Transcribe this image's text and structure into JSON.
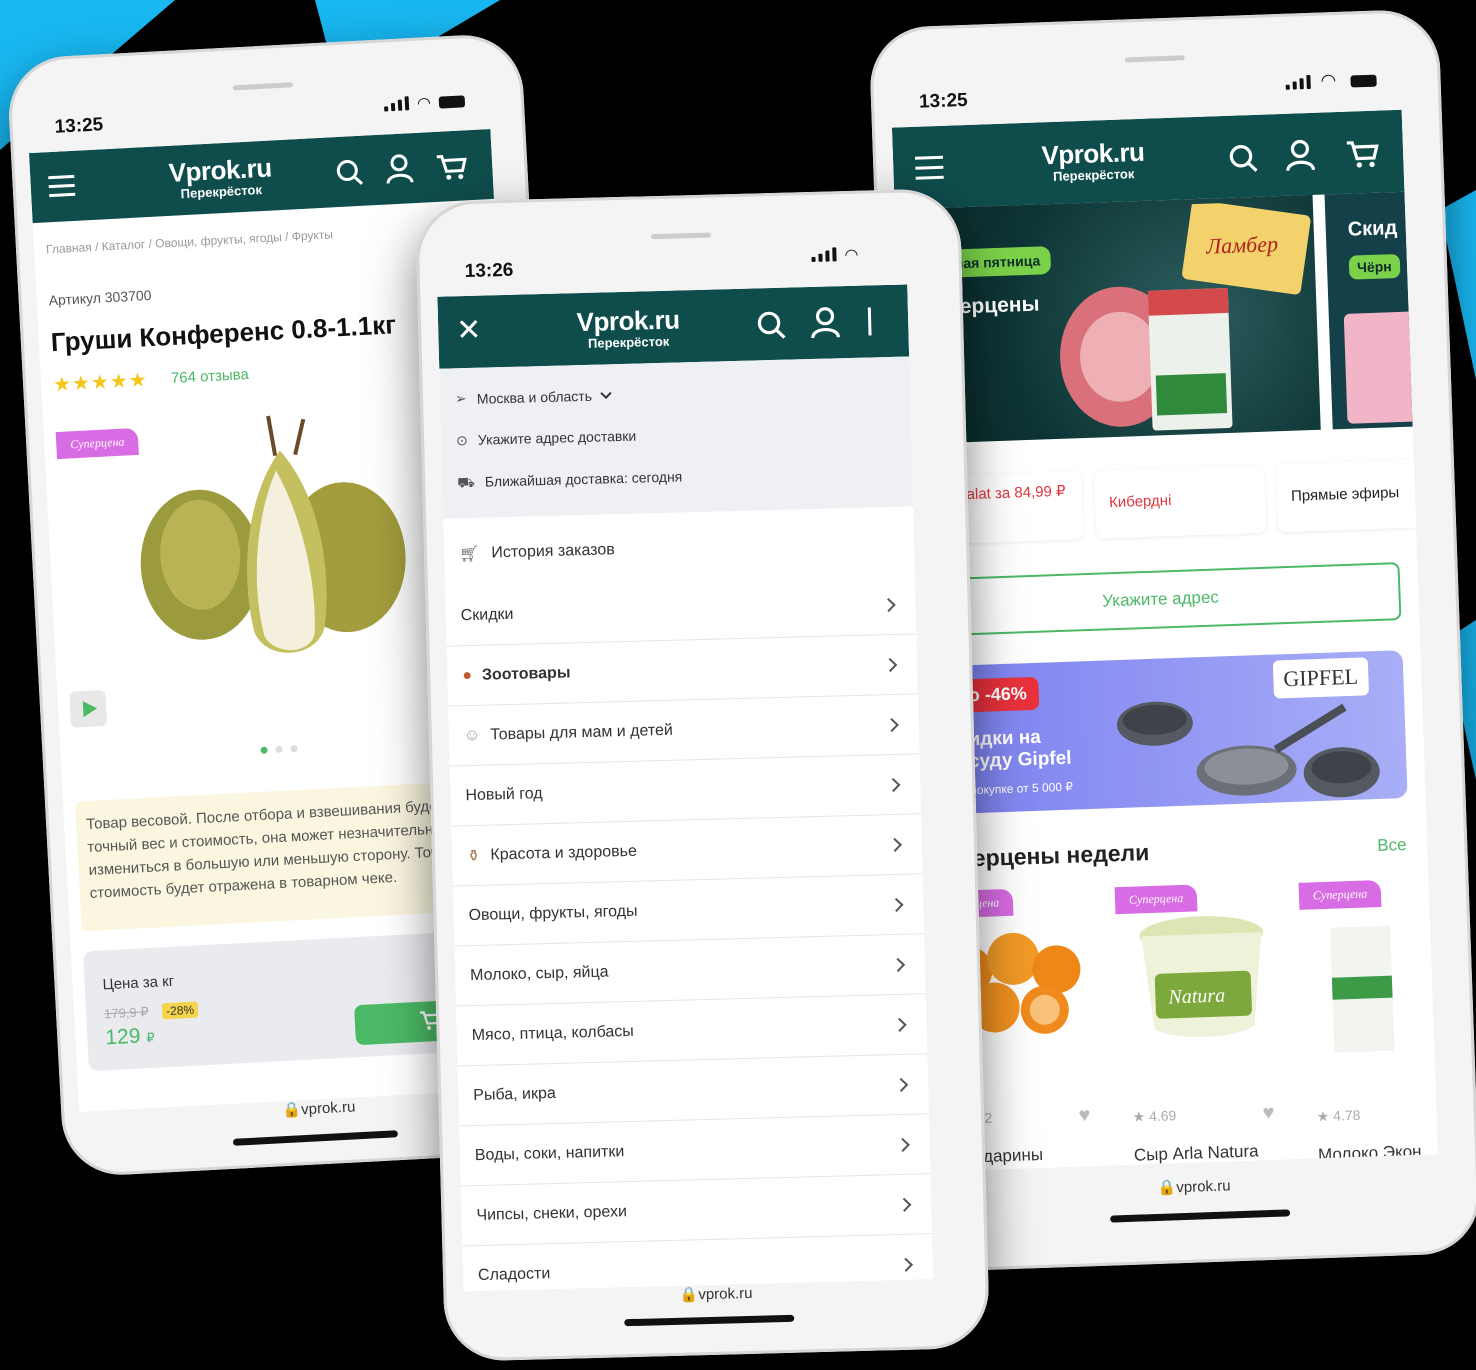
{
  "colors": {
    "brand_header": "#0f4d4d",
    "accent_green": "#4bb966",
    "badge_pink": "#d86ce4",
    "deco_blue": "#18b8f2"
  },
  "phone1": {
    "time": "13:25",
    "brand": "Vprok.ru",
    "brand_sub": "Перекрёсток",
    "breadcrumb": "Главная / Каталог / Овощи, фрукты, ягоды / Фрукты",
    "sku": "Артикул 303700",
    "title": "Груши Конференс 0.8-1.1кг",
    "reviews": "764 отзыва",
    "badge": "Суперцена",
    "weight_note": "Товар весовой. После отбора и взвешивания будем знать точный вес и стоимость, она может незначительно измениться в большую или меньшую сторону. Точная стоимость будет отражена в товарном чеке.",
    "price_label": "Цена за кг",
    "old_price": "179,9 ₽",
    "discount": "-28%",
    "price": "129",
    "currency": "₽",
    "url": "vprok.ru"
  },
  "phone2": {
    "time": "13:26",
    "brand": "Vprok.ru",
    "brand_sub": "Перекрёсток",
    "region": "Москва и область",
    "address_prompt": "Укажите адрес доставки",
    "delivery": "Ближайшая доставка: сегодня",
    "history": "История заказов",
    "menu": [
      "Скидки",
      "Зоотовары",
      "Товары для мам и детей",
      "Новый год",
      "Красота и здоровье",
      "Овощи, фрукты, ягоды",
      "Молоко, сыр, яйца",
      "Мясо, птица, колбасы",
      "Рыба, икра",
      "Воды, соки, напитки",
      "Чипсы, снеки, орехи",
      "Сладости"
    ],
    "url": "vprok.ru"
  },
  "phone3": {
    "time": "13:25",
    "brand": "Vprok.ru",
    "brand_sub": "Перекрёсток",
    "banner_tag": "Чёрная пятница",
    "banner_title": "Суперцены",
    "banner2_title": "Скид",
    "banner2_tag": "Чёрн",
    "chips": [
      "Parmalat за 84,99 ₽",
      "Киберднi",
      "Прямые эфиры"
    ],
    "address_button": "Укажите адрес",
    "promo_discount": "До -46%",
    "promo_title": "Скидки на посуду Gipfel",
    "promo_sub": "при покупке от 5 000 ₽",
    "promo_brand": "GIPFEL",
    "section_title": "Суперцены недели",
    "section_all": "Все",
    "products": [
      {
        "badge": "Суперцена",
        "rating": "4.32",
        "name": "Мандарины"
      },
      {
        "badge": "Суперцена",
        "rating": "4.69",
        "name": "Сыр Arla Natura"
      },
      {
        "badge": "Суперцена",
        "rating": "4.78",
        "name": "Молоко Экон"
      }
    ],
    "url": "vprok.ru"
  }
}
